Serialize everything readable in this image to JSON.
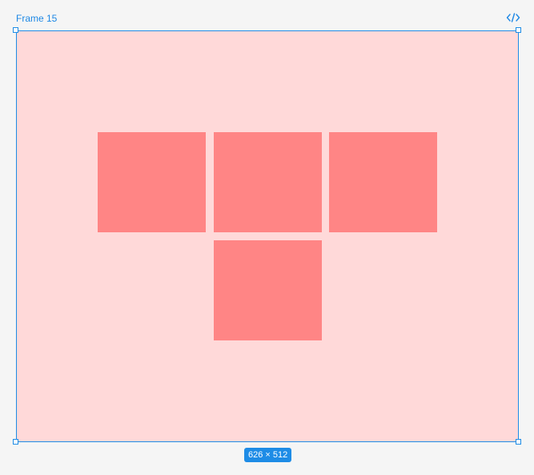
{
  "frame": {
    "name": "Frame 15",
    "size_label": "626 × 512",
    "fill_color": "#ffd9d9",
    "selection_color": "#1e8ce6"
  },
  "toolbar": {
    "code_icon": "code-brackets-icon"
  },
  "tiles": {
    "count": 4,
    "fill_color": "#ff8585"
  }
}
